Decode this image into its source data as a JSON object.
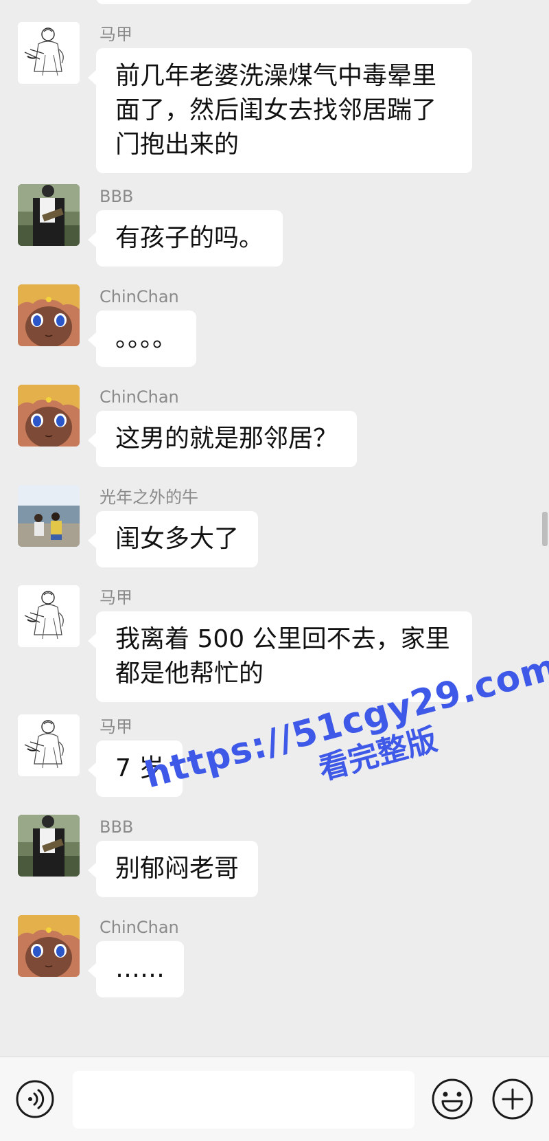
{
  "messages": [
    {
      "sender": "马甲",
      "avatar": "sketch-avatar",
      "text": "前几年老婆洗澡煤气中毒晕里面了，然后闺女去找邻居踹了门抱出来的"
    },
    {
      "sender": "BBB",
      "avatar": "man-outdoor-avatar",
      "text": "有孩子的吗。"
    },
    {
      "sender": "ChinChan",
      "avatar": "anime-girl-avatar",
      "text": "。。。。"
    },
    {
      "sender": "ChinChan",
      "avatar": "anime-girl-avatar",
      "text": "这男的就是那邻居？"
    },
    {
      "sender": "光年之外的牛",
      "avatar": "kids-photo-avatar",
      "text": "闺女多大了"
    },
    {
      "sender": "马甲",
      "avatar": "sketch-avatar",
      "text": "我离着 500 公里回不去，家里都是他帮忙的"
    },
    {
      "sender": "马甲",
      "avatar": "sketch-avatar",
      "text": "7 岁"
    },
    {
      "sender": "BBB",
      "avatar": "man-outdoor-avatar",
      "text": "别郁闷老哥"
    },
    {
      "sender": "ChinChan",
      "avatar": "anime-girl-avatar",
      "text": "……"
    }
  ],
  "watermark": {
    "url": "https://51cgy29.com",
    "subtitle": "看完整版"
  },
  "input_bar": {
    "voice_icon": "voice-icon",
    "input_value": "",
    "emoji_icon": "emoji-icon",
    "plus_icon": "plus-icon"
  },
  "colors": {
    "background": "#ededed",
    "bubble": "#ffffff",
    "sender_name": "#8a8a8a",
    "watermark": "#3e58e8"
  }
}
